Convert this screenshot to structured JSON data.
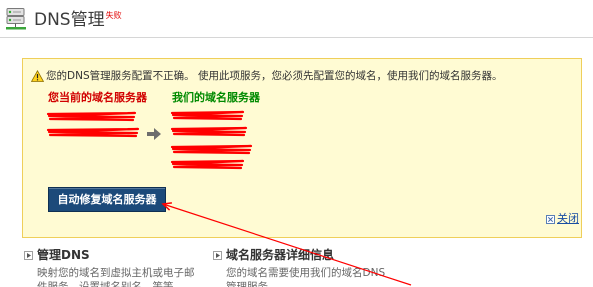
{
  "header": {
    "title": "DNS管理",
    "status_tag": "失败"
  },
  "alert": {
    "message": "您的DNS管理服务配置不正确。 使用此项服务，您必须先配置您的域名，使用我们的域名服务器。",
    "current_servers_heading": "您当前的域名服务器",
    "our_servers_heading": "我们的域名服务器",
    "fix_button": "自动修复域名服务器",
    "close_link": "关闭"
  },
  "sections": [
    {
      "title": "管理DNS",
      "description_lines": [
        "映射您的域名到虚拟主机或电子邮",
        "件服务，设置域名别名，等等。"
      ]
    },
    {
      "title": "域名服务器详细信息",
      "description_lines": [
        "您的域名需要使用我们的域名DNS",
        "管理服务。"
      ]
    }
  ],
  "icons": {
    "header": "server-icon",
    "alert": "warning-icon",
    "transfer": "arrow-right-icon",
    "close": "close-icon",
    "section_bullet": "arrow-bullet-icon"
  },
  "colors": {
    "status_tag": "#e00000",
    "alert_background": "#fffbd3",
    "alert_border": "#efcf5a",
    "current_servers_heading": "#d10000",
    "our_servers_heading": "#008a00",
    "fix_button_background": "#1c4a7a",
    "link": "#1a4ea3",
    "redaction": "#ff0000",
    "annotation": "#ff0000"
  }
}
